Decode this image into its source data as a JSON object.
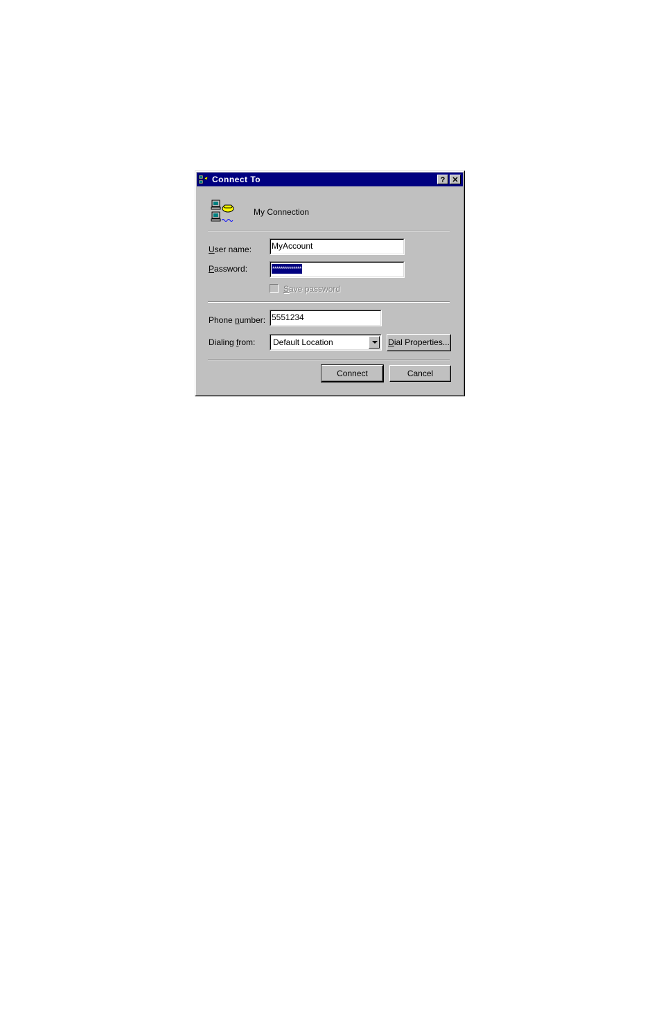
{
  "dialog": {
    "title": "Connect To",
    "help_glyph": "?",
    "close_glyph": "✕",
    "connection_name": "My Connection",
    "icons": {
      "title": "dial-up-networking-icon",
      "connection": "connection-computers-icon"
    }
  },
  "form": {
    "username": {
      "accesskey": "U",
      "label_rest": "ser name:",
      "value": "MyAccount"
    },
    "password": {
      "accesskey": "P",
      "label_rest": "assword:",
      "value": "**************"
    },
    "save_password": {
      "accesskey": "S",
      "label_rest": "ave password",
      "checked": false,
      "enabled": false
    },
    "phone": {
      "label_pre": "Phone ",
      "accesskey": "n",
      "label_rest": "umber:",
      "value": "5551234"
    },
    "dialing_from": {
      "label_pre": "Dialing ",
      "accesskey": "f",
      "label_rest": "rom:",
      "value": "Default Location"
    }
  },
  "buttons": {
    "dial_properties": {
      "accesskey": "D",
      "label_rest": "ial Properties..."
    },
    "connect": "Connect",
    "cancel": "Cancel"
  },
  "colors": {
    "titlebar": "#000080",
    "face": "#c0c0c0",
    "selection": "#000080"
  }
}
